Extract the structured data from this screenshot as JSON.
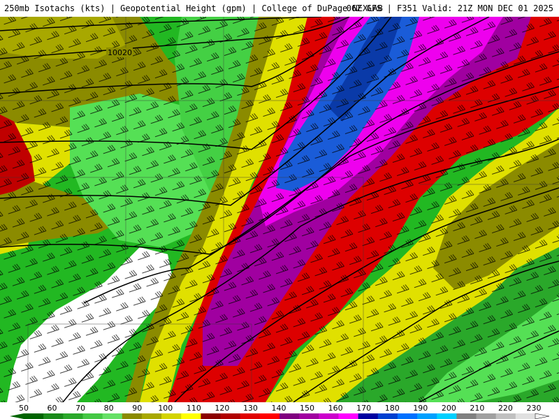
{
  "header": {
    "left_title": "250mb Isotachs (kts) | Geopotential Height (gpm) | College of DuPage NEXLAB",
    "right_title": "06Z GFS | F351 Valid: 21Z MON DEC 01 2025"
  },
  "map": {
    "contour_labels": [
      {
        "text": "10020"
      }
    ],
    "wind_barbs": "uniform-westerly-southwesterly"
  },
  "colorbar": {
    "ticks": [
      "50",
      "60",
      "70",
      "80",
      "90",
      "100",
      "110",
      "120",
      "130",
      "140",
      "150",
      "160",
      "170",
      "180",
      "190",
      "200",
      "210",
      "220",
      "230"
    ],
    "colors": [
      "#006400",
      "#1a8a1a",
      "#2aa82a",
      "#44c844",
      "#66e066",
      "#8b8b00",
      "#a8a800",
      "#d4d400",
      "#ffff00",
      "#8b0000",
      "#b00000",
      "#e00000",
      "#ff0000",
      "#800080",
      "#a000a0",
      "#cc00cc",
      "#ff00ff",
      "#0000a0",
      "#0040d0",
      "#0070ff",
      "#00a0ff",
      "#00d0ff",
      "#808080",
      "#a0a0a0",
      "#c0c0c0",
      "#e0e0e0"
    ]
  }
}
